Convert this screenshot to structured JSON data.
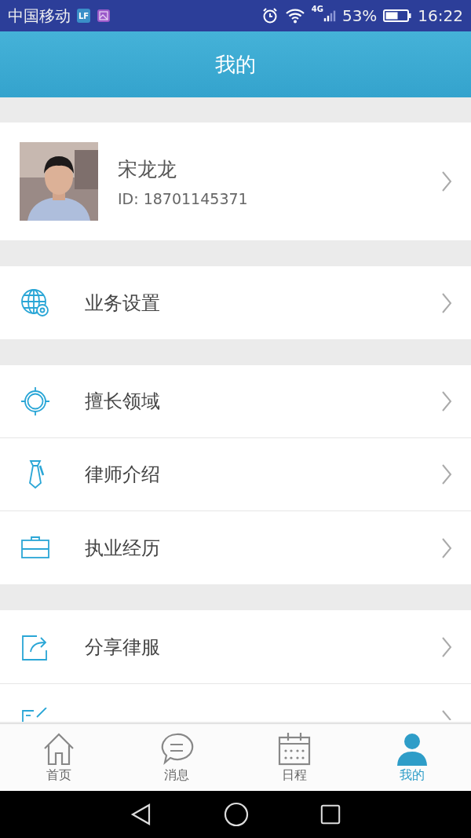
{
  "status_bar": {
    "carrier": "中国移动",
    "badge": "LF",
    "network": "4G",
    "battery": "53%",
    "time": "16:22"
  },
  "header": {
    "title": "我的"
  },
  "profile": {
    "name": "宋龙龙",
    "id": "ID: 18701145371"
  },
  "groups": [
    [
      {
        "kind": "globe",
        "label": "业务设置"
      }
    ],
    [
      {
        "kind": "target",
        "label": "擅长领域"
      },
      {
        "kind": "tie",
        "label": "律师介绍"
      },
      {
        "kind": "briefcase",
        "label": "执业经历"
      }
    ],
    [
      {
        "kind": "share",
        "label": "分享律服"
      }
    ]
  ],
  "tabs": [
    {
      "kind": "home",
      "label": "首页",
      "selected": false
    },
    {
      "kind": "chat",
      "label": "消息",
      "selected": false
    },
    {
      "kind": "calendar",
      "label": "日程",
      "selected": false
    },
    {
      "kind": "person",
      "label": "我的",
      "selected": true
    }
  ]
}
